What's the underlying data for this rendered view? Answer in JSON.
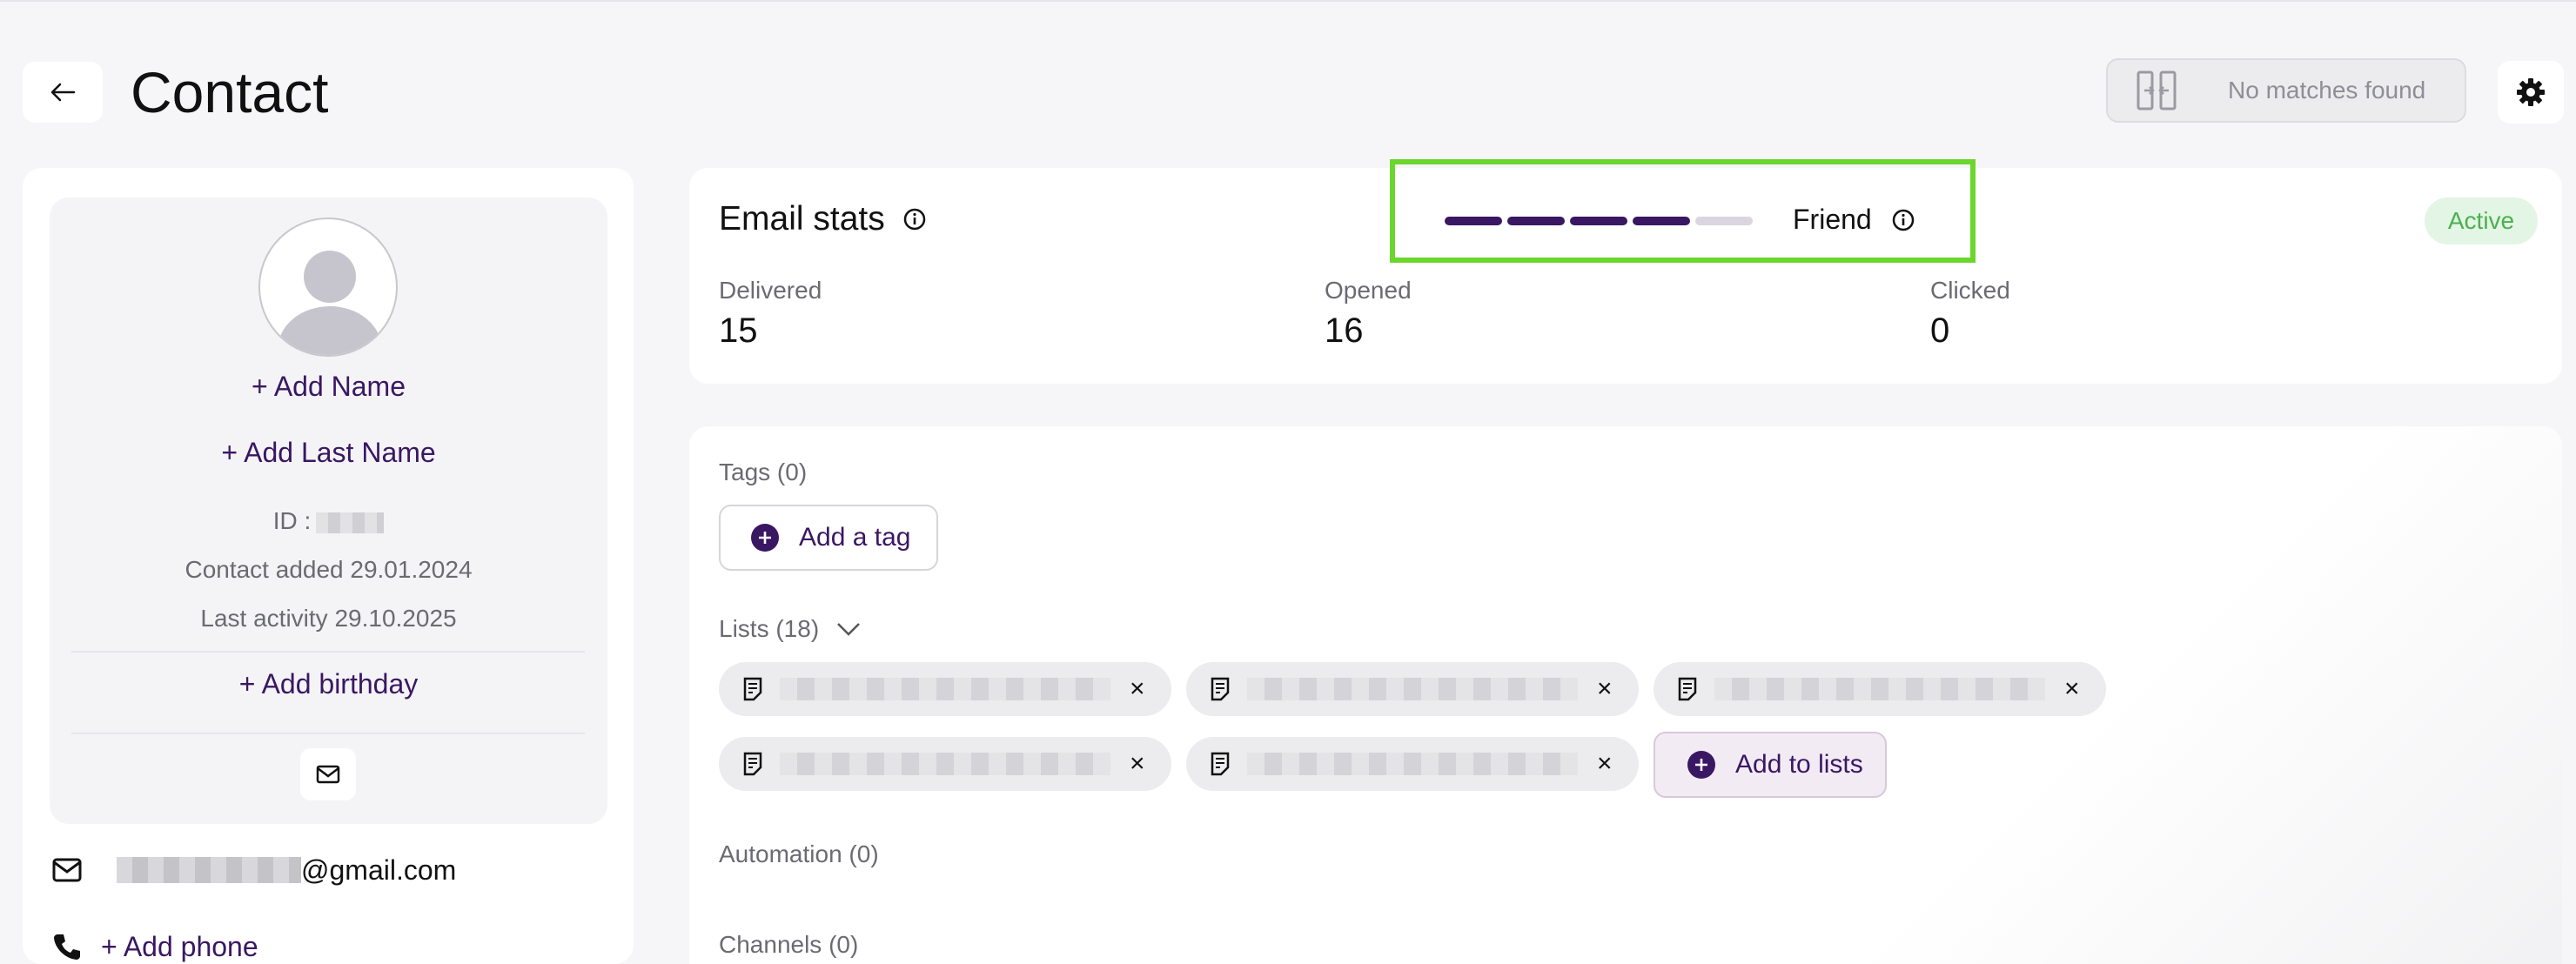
{
  "header": {
    "title": "Contact",
    "matches_text": "No matches found"
  },
  "profile": {
    "add_name": "+ Add Name",
    "add_last_name": "+ Add Last Name",
    "id_label": "ID :",
    "contact_added": "Contact added 29.01.2024",
    "last_activity": "Last activity 29.10.2025",
    "add_birthday": "+ Add birthday",
    "email_suffix": "@gmail.com",
    "add_phone": "+ Add phone"
  },
  "email_stats": {
    "title": "Email stats",
    "engagement_level": "Friend",
    "engagement_score": 4,
    "engagement_max": 5,
    "status": "Active",
    "delivered_label": "Delivered",
    "delivered_value": "15",
    "opened_label": "Opened",
    "opened_value": "16",
    "clicked_label": "Clicked",
    "clicked_value": "0"
  },
  "details": {
    "tags_label": "Tags (0)",
    "add_tag": "Add a tag",
    "lists_label": "Lists (18)",
    "add_to_lists": "Add to lists",
    "automation_label": "Automation (0)",
    "channels_label": "Channels (0)",
    "list_chip_prefixes": [
      "",
      "(",
      "",
      "",
      ""
    ]
  },
  "colors": {
    "brand": "#3a1763",
    "highlight": "#6bd62c",
    "active_bg": "#e3f5e4",
    "active_text": "#4cb050",
    "segment_inactive": "#d9d6e0"
  }
}
